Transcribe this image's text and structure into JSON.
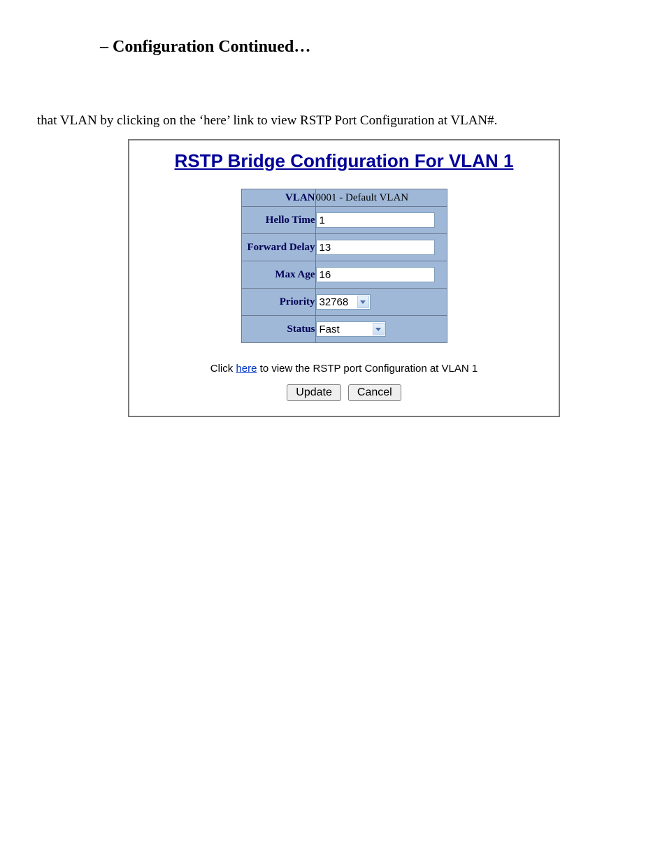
{
  "doc": {
    "heading": "– Configuration Continued…",
    "body_text": "that VLAN by clicking on the ‘here’ link to view RSTP Port Configuration at VLAN#."
  },
  "panel": {
    "title": "RSTP Bridge Configuration For VLAN 1",
    "rows": {
      "vlan": {
        "label": "VLAN",
        "value": "0001 - Default VLAN"
      },
      "hello_time": {
        "label": "Hello Time",
        "value": "1"
      },
      "forward_delay": {
        "label": "Forward Delay",
        "value": "13"
      },
      "max_age": {
        "label": "Max Age",
        "value": "16"
      },
      "priority": {
        "label": "Priority",
        "value": "32768"
      },
      "status": {
        "label": "Status",
        "value": "Fast"
      }
    },
    "link_line": {
      "pre": "Click ",
      "link": "here",
      "post": " to view the RSTP port Configuration at VLAN 1"
    },
    "buttons": {
      "update": "Update",
      "cancel": "Cancel"
    }
  }
}
